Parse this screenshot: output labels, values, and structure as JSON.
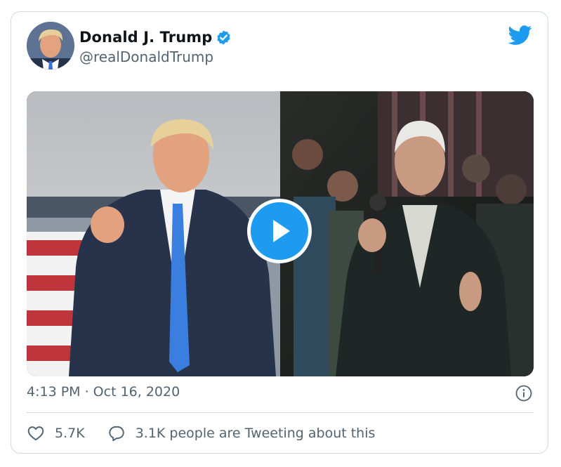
{
  "tweet": {
    "display_name": "Donald J. Trump",
    "handle": "@realDonaldTrump",
    "timestamp": "4:13 PM · Oct 16, 2020",
    "likes": "5.7K",
    "conversation": "3.1K people are Tweeting about this"
  },
  "icons": {
    "brand": "twitter-bird-icon",
    "verified": "verified-badge-icon",
    "info": "info-icon",
    "like": "heart-icon",
    "reply": "speech-bubble-icon",
    "media": "play-icon"
  },
  "colors": {
    "accent": "#1d9bf0",
    "text": "#0f1419",
    "secondary": "#536471",
    "border": "#cfd9de"
  }
}
